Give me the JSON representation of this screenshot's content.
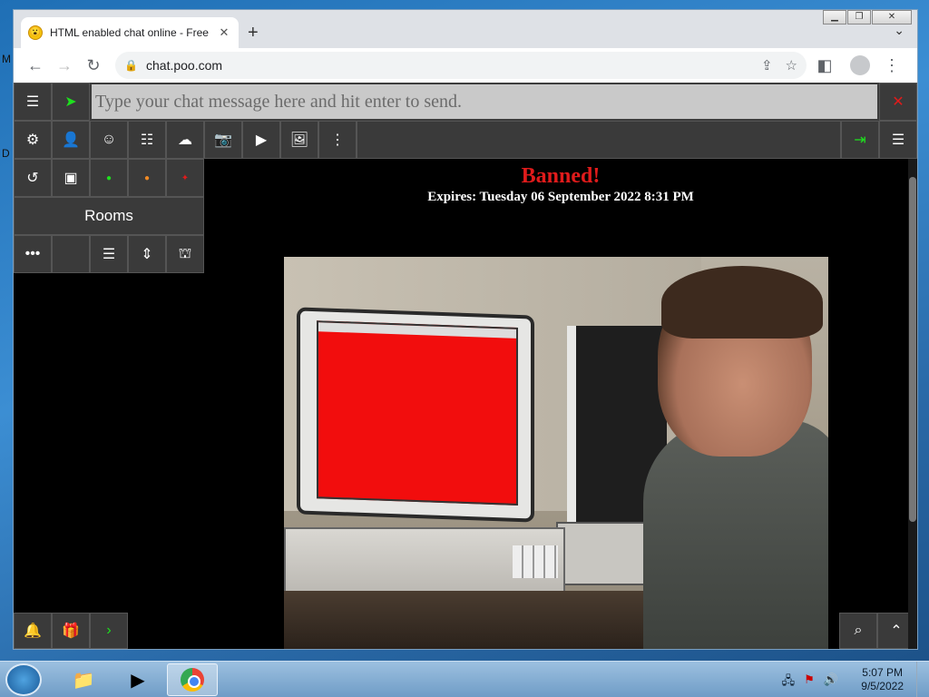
{
  "desktop": {
    "edge_letters": [
      "M",
      "D"
    ]
  },
  "browser": {
    "tab_title": "HTML enabled chat online - Free",
    "tab_close": "✕",
    "new_tab": "+",
    "url": "chat.poo.com"
  },
  "chat": {
    "input_placeholder": "Type your chat message here and hit enter to send.",
    "rooms_label": "Rooms",
    "ban_title": "Banned!",
    "ban_expires": "Expires: Tuesday 06 September 2022 8:31 PM"
  },
  "taskbar": {
    "time": "5:07 PM",
    "date": "9/5/2022"
  },
  "colors": {
    "accent_green": "#1ee01e",
    "ban_red": "#e01b1b",
    "close_red": "#e01b1b",
    "button_bg": "#3a3a3a"
  }
}
